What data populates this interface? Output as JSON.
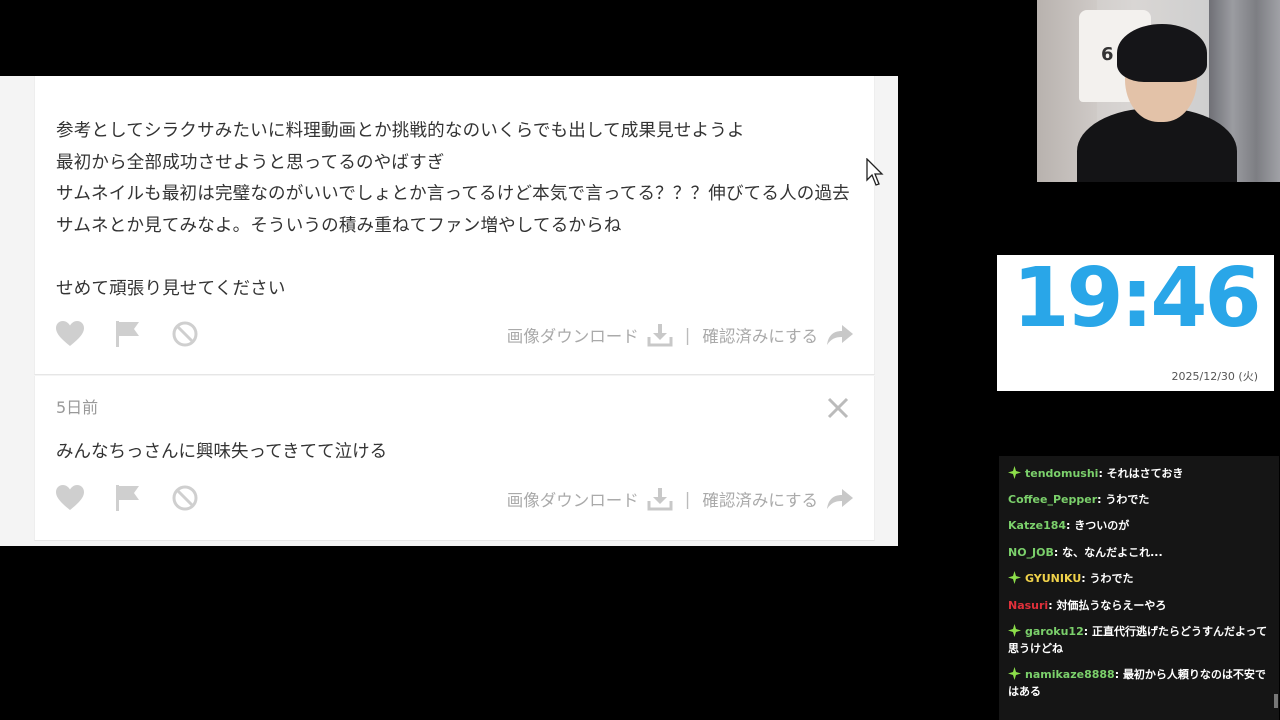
{
  "comments": [
    {
      "lines": [
        "参考としてシラクサみたいに料理動画とか挑戦的なのいくらでも出して成果見せようよ",
        "最初から全部成功させようと思ってるのやばすぎ",
        "サムネイルも最初は完璧なのがいいでしょとか言ってるけど本気で言ってる？？？伸びてる人の過去",
        "サムネとか見てみなよ。そういうの積み重ねてファン増やしてるからね",
        "",
        "せめて頑張り見せてください"
      ],
      "download_label": "画像ダウンロード",
      "confirm_label": "確認済みにする"
    },
    {
      "timestamp": "5日前",
      "text": "みんなちっさんに興味失ってきてて泣ける",
      "download_label": "画像ダウンロード",
      "confirm_label": "確認済みにする"
    }
  ],
  "separator": "|",
  "clock": {
    "time": "19:46",
    "date": "2025/12/30 (火)",
    "color": "#29a6e8"
  },
  "webcam": {
    "jersey_number": "6"
  },
  "chat": {
    "messages": [
      {
        "user": "tendomushi",
        "text": "それはさておき",
        "badge": true,
        "color": "#7bd06b"
      },
      {
        "user": "Coffee_Pepper",
        "text": "うわでた",
        "badge": false,
        "color": "#7bd06b"
      },
      {
        "user": "Katze184",
        "text": "きついのが",
        "badge": false,
        "color": "#7bd06b"
      },
      {
        "user": "NO_JOB",
        "text": "な、なんだよこれ...",
        "badge": false,
        "color": "#7bd06b"
      },
      {
        "user": "GYUNIKU",
        "text": "うわでた",
        "badge": true,
        "color": "#f0d24a"
      },
      {
        "user": "Nasuri",
        "text": "対価払うならえーやろ",
        "badge": false,
        "color": "#e0303a"
      },
      {
        "user": "garoku12",
        "text": "正直代行逃げたらどうすんだよって思うけどね",
        "badge": true,
        "color": "#7bd06b"
      },
      {
        "user": "namikaze8888",
        "text": "最初から人頼りなのは不安ではある",
        "badge": true,
        "color": "#7bd06b"
      }
    ]
  }
}
